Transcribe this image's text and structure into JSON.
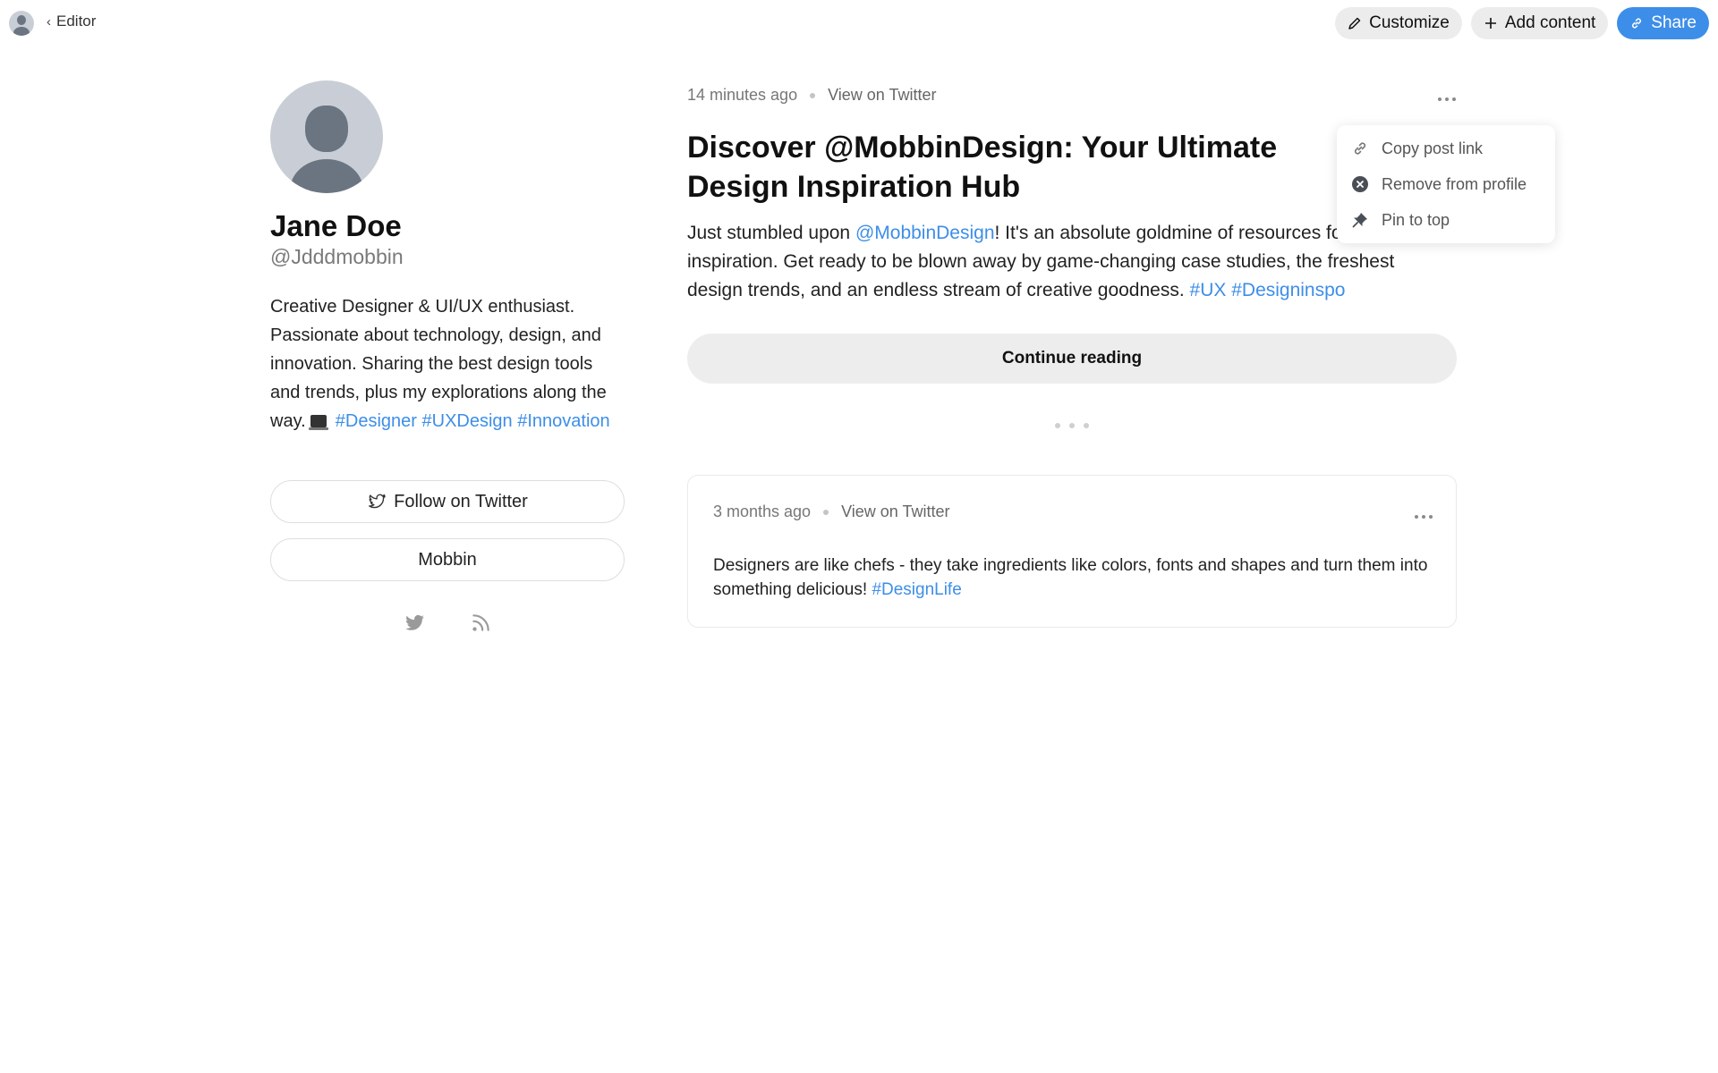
{
  "topbar": {
    "back_label": "Editor",
    "customize_label": "Customize",
    "add_content_label": "Add content",
    "share_label": "Share"
  },
  "profile": {
    "name": "Jane Doe",
    "handle": "@Jdddmobbin",
    "bio_text": "Creative Designer & UI/UX enthusiast. Passionate about technology, design, and innovation. Sharing the best design tools and trends, plus my explorations along the way.",
    "bio_tags": [
      "#Designer",
      "#UXDesign",
      "#Innovation"
    ],
    "follow_label": "Follow on Twitter",
    "link_label": "Mobbin",
    "social_icons": [
      "twitter-icon",
      "rss-icon"
    ]
  },
  "post1": {
    "time": "14 minutes ago",
    "view_link": "View on Twitter",
    "title": "Discover @MobbinDesign: Your Ultimate Design Inspiration Hub",
    "body_start": "Just stumbled upon ",
    "mention": "@MobbinDesign",
    "body_rest": "! It's an absolute goldmine of resources for design inspiration. Get ready to be blown away by game-changing case studies, the freshest design trends, and an endless stream of creative goodness. ",
    "tags": [
      "#UX",
      "#Designinspo"
    ],
    "continue_label": "Continue reading"
  },
  "post2": {
    "time": "3 months ago",
    "view_link": "View on Twitter",
    "body": "Designers are like chefs - they take ingredients like colors, fonts and shapes and turn them into something delicious! ",
    "tag": "#DesignLife"
  },
  "menu": {
    "items": [
      {
        "label": "Copy post link",
        "icon": "link-icon"
      },
      {
        "label": "Remove from profile",
        "icon": "close-circle-icon"
      },
      {
        "label": "Pin to top",
        "icon": "pin-icon"
      }
    ]
  },
  "colors": {
    "accent": "#3d8ee8",
    "pill_bg": "#ececec",
    "muted_text": "#7a7a7a"
  }
}
